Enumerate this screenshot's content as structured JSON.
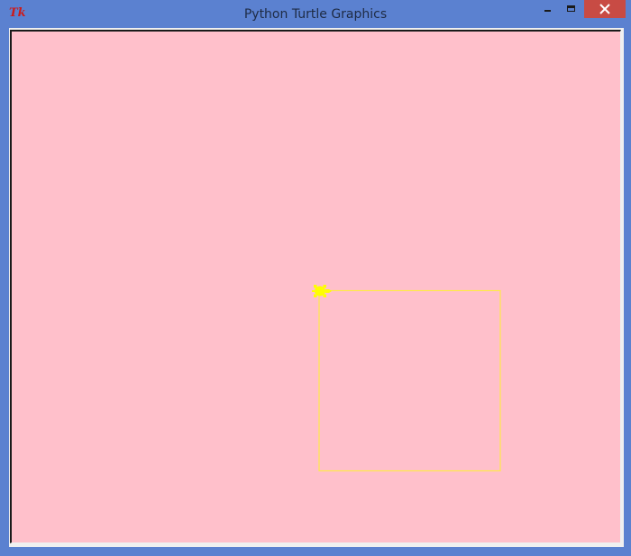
{
  "window": {
    "title": "Python Turtle Graphics",
    "app_icon_text": "Tk",
    "controls": {
      "minimize": "minimize-icon",
      "maximize": "maximize-icon",
      "close": "close-icon"
    },
    "colors": {
      "frame": "#5b81d0",
      "close_button": "#c84b44"
    }
  },
  "canvas": {
    "background": "#ffc0cb",
    "pen_color": "#ffe94a",
    "turtle_color": "#ffff00",
    "turtle_shape": "turtle-icon"
  }
}
